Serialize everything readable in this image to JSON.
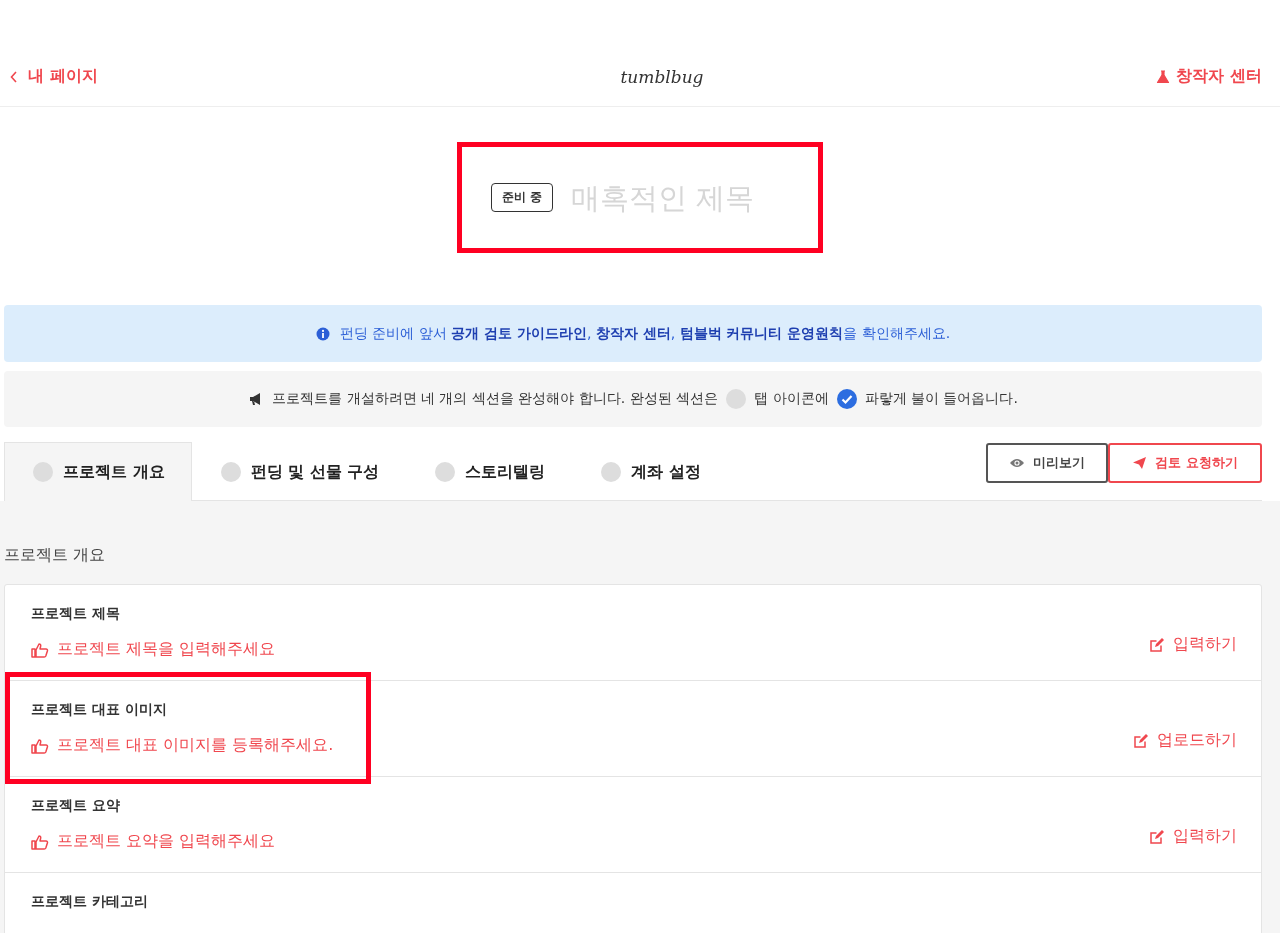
{
  "header": {
    "back": "내 페이지",
    "logo": "tumblbug",
    "creator_center": "창작자 센터"
  },
  "title_area": {
    "status": "준비 중",
    "placeholder": "매혹적인 제목",
    "highlighted": true
  },
  "info_banner": "펀딩 준비에 앞서 **공개 검토 가이드라인**, **창작자 센터**, **텀블벅 커뮤니티 운영원칙**을 확인해주세요.",
  "notice": {
    "before": "프로젝트를 개설하려면 네 개의 섹션을 완성해야 합니다. 완성된 섹션은",
    "middle": "탭 아이콘에",
    "after": "파랗게 불이 들어옵니다."
  },
  "tabs": [
    {
      "label": "프로젝트 개요",
      "selected": true,
      "completed": false
    },
    {
      "label": "펀딩 및 선물 구성",
      "selected": false,
      "completed": false
    },
    {
      "label": "스토리텔링",
      "selected": false,
      "completed": false
    },
    {
      "label": "계좌 설정",
      "selected": false,
      "completed": false
    }
  ],
  "buttons": [
    {
      "label": "미리보기",
      "kind": "preview"
    },
    {
      "label": "검토 요청하기",
      "kind": "submit"
    }
  ],
  "section_title": "프로젝트 개요",
  "fields": [
    {
      "label": "프로젝트 제목",
      "prompt": "프로젝트 제목을 입력해주세요",
      "action": "입력하기",
      "highlighted": false
    },
    {
      "label": "프로젝트 대표 이미지",
      "prompt": "프로젝트 대표 이미지를 등록해주세요.",
      "action": "업로드하기",
      "highlighted": true
    },
    {
      "label": "프로젝트 요약",
      "prompt": "프로젝트 요약을 입력해주세요",
      "action": "입력하기",
      "highlighted": false
    },
    {
      "label": "프로젝트 카테고리",
      "highlighted": false
    }
  ]
}
